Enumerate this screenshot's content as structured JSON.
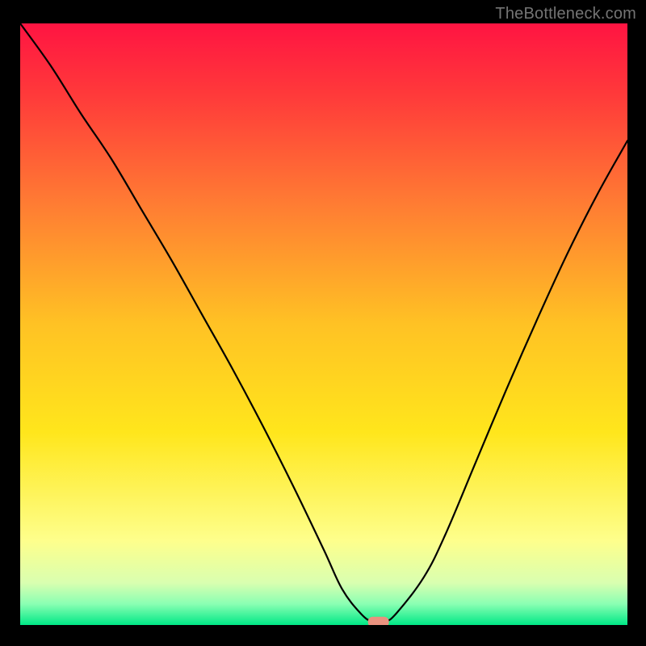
{
  "watermark": "TheBottleneck.com",
  "colors": {
    "top_red": "#ff1442",
    "mid_orange": "#ffab2e",
    "yellow": "#ffe61c",
    "light_yellow": "#feff8c",
    "pale_green": "#c8ffa2",
    "green": "#00e886",
    "marker": "#e9927f",
    "curve": "#000000",
    "frame": "#000000",
    "watermark_text": "#747474"
  },
  "chart_data": {
    "type": "line",
    "title": "",
    "xlabel": "",
    "ylabel": "",
    "xlim": [
      0,
      100
    ],
    "ylim": [
      0,
      100
    ],
    "grid": false,
    "legend": false,
    "series": [
      {
        "name": "bottleneck-curve",
        "x": [
          0,
          5,
          10,
          15,
          20,
          25,
          30,
          35,
          40,
          45,
          50,
          53,
          56,
          58,
          60,
          62,
          66.5,
          70,
          75,
          80,
          85,
          90,
          95,
          100
        ],
        "values": [
          100,
          93,
          85,
          77.5,
          69,
          60.5,
          51.5,
          42.5,
          33,
          23,
          12.5,
          6,
          2,
          0.5,
          0.5,
          2,
          8,
          15,
          27,
          39,
          50.5,
          61.5,
          71.5,
          80.5
        ]
      }
    ],
    "annotations": [
      {
        "name": "marker",
        "x": 59,
        "y": 0.5,
        "shape": "pill"
      }
    ],
    "background_gradient": {
      "type": "vertical",
      "stops": [
        {
          "pos": 0.0,
          "color": "#ff1442"
        },
        {
          "pos": 0.12,
          "color": "#ff3a3a"
        },
        {
          "pos": 0.3,
          "color": "#ff7c33"
        },
        {
          "pos": 0.5,
          "color": "#ffc224"
        },
        {
          "pos": 0.68,
          "color": "#ffe61c"
        },
        {
          "pos": 0.86,
          "color": "#feff8c"
        },
        {
          "pos": 0.93,
          "color": "#d9ffb0"
        },
        {
          "pos": 0.965,
          "color": "#8affb3"
        },
        {
          "pos": 1.0,
          "color": "#00e886"
        }
      ]
    }
  }
}
